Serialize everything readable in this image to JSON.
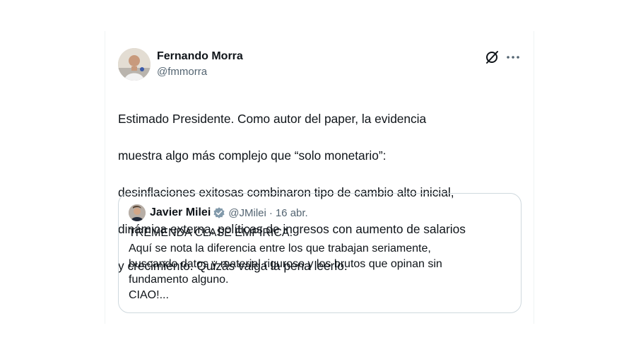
{
  "tweet": {
    "author": {
      "display_name": "Fernando Morra",
      "handle": "@fmmorra"
    },
    "text": "Estimado Presidente. Como autor del paper, la evidencia muestra algo más complejo que “solo monetario”: desinflaciones exitosas combinaron tipo de cambio alto inicial, dinámica externa, políticas de ingresos con aumento de salarios y crecimiento. Quizás valga la pena leerlo.",
    "text_lines": [
      "Estimado Presidente. Como autor del paper, la evidencia",
      "muestra algo más complejo que “solo monetario”:",
      "desinflaciones exitosas combinaron tipo de cambio alto inicial,",
      "dinámica externa, políticas de ingresos con aumento de salarios",
      "y crecimiento. Quizás valga la pena leerlo."
    ]
  },
  "header_icons": {
    "grok": "grok-icon",
    "more": "more-icon"
  },
  "quoted_tweet": {
    "author": {
      "display_name": "Javier Milei",
      "handle": "@JMilei",
      "verified": true
    },
    "separator": "·",
    "date": "16 abr.",
    "lines": [
      "TREMENDA CLASE EMPÍRICA.",
      "Aquí se nota la diferencia entre los que trabajan seriamente,",
      "buscando datos y material riguroso y los brutos que opinan sin",
      "fundamento alguno.",
      "CIAO!..."
    ]
  },
  "colors": {
    "text_primary": "#0f1419",
    "text_secondary": "#536471",
    "border": "#cfd9de",
    "verified_badge": "#829aab"
  }
}
